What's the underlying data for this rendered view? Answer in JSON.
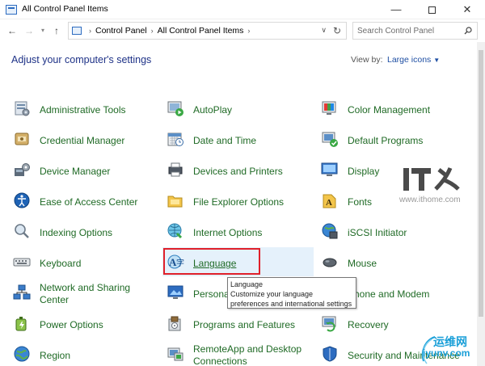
{
  "window": {
    "title": "All Control Panel Items",
    "minimize_glyph": "—",
    "close_glyph": "✕"
  },
  "address": {
    "breadcrumbs": [
      "Control Panel",
      "All Control Panel Items"
    ],
    "search_placeholder": "Search Control Panel"
  },
  "header": {
    "title": "Adjust your computer's settings",
    "view_by_label": "View by:",
    "view_by_value": "Large icons"
  },
  "items": {
    "col1": [
      {
        "label": "Administrative Tools",
        "icon": "administrative-tools-icon"
      },
      {
        "label": "Credential Manager",
        "icon": "credential-manager-icon"
      },
      {
        "label": "Device Manager",
        "icon": "device-manager-icon"
      },
      {
        "label": "Ease of Access Center",
        "icon": "ease-of-access-icon"
      },
      {
        "label": "Indexing Options",
        "icon": "indexing-options-icon"
      },
      {
        "label": "Keyboard",
        "icon": "keyboard-icon"
      },
      {
        "label": "Network and Sharing Center",
        "icon": "network-sharing-icon"
      },
      {
        "label": "Power Options",
        "icon": "power-options-icon"
      },
      {
        "label": "Region",
        "icon": "region-icon"
      }
    ],
    "col2": [
      {
        "label": "AutoPlay",
        "icon": "autoplay-icon"
      },
      {
        "label": "Date and Time",
        "icon": "date-time-icon"
      },
      {
        "label": "Devices and Printers",
        "icon": "devices-printers-icon"
      },
      {
        "label": "File Explorer Options",
        "icon": "file-explorer-options-icon"
      },
      {
        "label": "Internet Options",
        "icon": "internet-options-icon"
      },
      {
        "label": "Language",
        "icon": "language-icon"
      },
      {
        "label": "Personalization",
        "icon": "personalization-icon"
      },
      {
        "label": "Programs and Features",
        "icon": "programs-features-icon"
      },
      {
        "label": "RemoteApp and Desktop Connections",
        "icon": "remoteapp-icon"
      }
    ],
    "col3": [
      {
        "label": "Color Management",
        "icon": "color-management-icon"
      },
      {
        "label": "Default Programs",
        "icon": "default-programs-icon"
      },
      {
        "label": "Display",
        "icon": "display-icon"
      },
      {
        "label": "Fonts",
        "icon": "fonts-icon"
      },
      {
        "label": "iSCSI Initiator",
        "icon": "iscsi-initiator-icon"
      },
      {
        "label": "Mouse",
        "icon": "mouse-icon"
      },
      {
        "label": "Phone and Modem",
        "icon": "phone-modem-icon"
      },
      {
        "label": "Recovery",
        "icon": "recovery-icon"
      },
      {
        "label": "Security and Maintenance",
        "icon": "security-maintenance-icon"
      }
    ]
  },
  "tooltip": {
    "title": "Language",
    "description": "Customize your language preferences and international settings"
  },
  "watermarks": {
    "ithome_logo": "IT之家",
    "ithome_url": "www.ithome.com",
    "site2_name": "运维网",
    "site2_url": "iyunv.com"
  },
  "colors": {
    "link_green": "#1f6a25",
    "heading_blue": "#1e3287",
    "highlight_red": "#e0202a",
    "hover_blue": "#e5f1fb"
  }
}
